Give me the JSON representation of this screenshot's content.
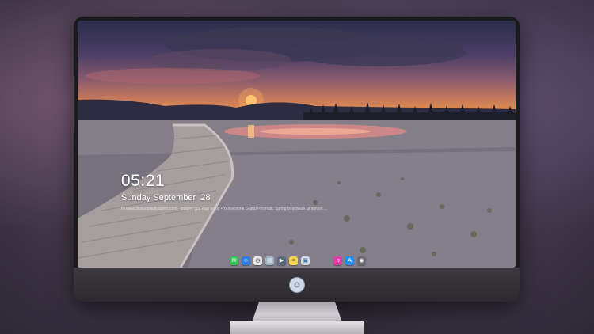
{
  "lock_screen": {
    "time": "05:21",
    "date": "Sunday September  28",
    "caption": "Hi www.desktopwallpapers.com - images you may enjoy • Yellowstone Grand Prismatic Spring boardwalk at sunset ..."
  },
  "dock": {
    "apps": [
      {
        "name": "messages",
        "glyph": "✉",
        "color": "#3cc35a"
      },
      {
        "name": "finder",
        "glyph": "☺",
        "color": "#2f7fe3"
      },
      {
        "name": "clock",
        "glyph": "◷",
        "color": "#e8e8e8"
      },
      {
        "name": "preview",
        "glyph": "▤",
        "color": "#9fb6c8"
      },
      {
        "name": "final-cut",
        "glyph": "▶",
        "color": "#5a6b7d"
      },
      {
        "name": "notes",
        "glyph": "≡",
        "color": "#f4d44d"
      },
      {
        "name": "photos",
        "glyph": "▣",
        "color": "#d6dde6"
      },
      {
        "name": "itunes",
        "glyph": "♫",
        "color": "#e23ea6"
      },
      {
        "name": "app-store",
        "glyph": "A",
        "color": "#1e90f0"
      },
      {
        "name": "camera",
        "glyph": "◉",
        "color": "#6a6a70"
      }
    ]
  },
  "monitor": {
    "logo": "☺"
  },
  "colors": {
    "sky_top": "#2c2d4a",
    "sunset": "#e08a4f",
    "ground": "#8a8790"
  }
}
